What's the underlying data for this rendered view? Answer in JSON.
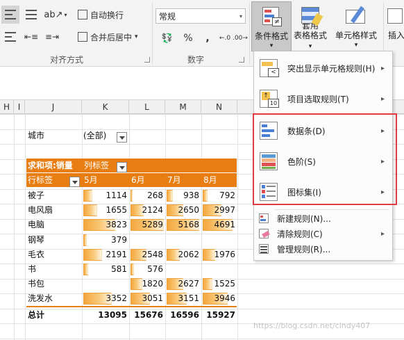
{
  "ribbon": {
    "wrap_text": "自动换行",
    "merge_center": "合并后居中",
    "merge_dd": "▾",
    "align_group": "对齐方式",
    "number_format": "常规",
    "number_group": "数字",
    "percent": "%",
    "comma": ",",
    "cond_format_line1": "条件格式",
    "cond_format_dd": "▾",
    "table_format_line1": "套用",
    "table_format_line2": "表格格式",
    "table_format_dd": "▾",
    "cell_style_line1": "单元格样式",
    "cell_style_dd": "▾",
    "insert_label": "插入"
  },
  "columns": [
    "H",
    "I",
    "J",
    "K",
    "L",
    "M",
    "N"
  ],
  "pivot": {
    "filter_label": "城市",
    "filter_value": "(全部)",
    "value_header": "求和项:销量",
    "col_label_header": "列标签",
    "row_label_header": "行标签",
    "months": [
      "5月",
      "6月",
      "7月",
      "8月"
    ],
    "max_value": 5289,
    "rows": [
      {
        "label": "被子",
        "values": [
          1114,
          268,
          938,
          792
        ]
      },
      {
        "label": "电风扇",
        "values": [
          1655,
          2124,
          2650,
          2997
        ]
      },
      {
        "label": "电脑",
        "values": [
          3823,
          5289,
          5168,
          4691
        ]
      },
      {
        "label": "钢琴",
        "values": [
          379,
          null,
          null,
          null
        ]
      },
      {
        "label": "毛衣",
        "values": [
          2191,
          2548,
          2062,
          1976
        ]
      },
      {
        "label": "书",
        "values": [
          581,
          576,
          null,
          null
        ]
      },
      {
        "label": "书包",
        "values": [
          null,
          1820,
          2627,
          1525
        ]
      },
      {
        "label": "洗发水",
        "values": [
          3352,
          3051,
          3151,
          3946
        ]
      }
    ],
    "total_label": "总计",
    "totals": [
      "13095",
      "15676",
      "16596",
      "15927"
    ]
  },
  "menu": {
    "highlight_rules": "突出显示单元格规则(H)",
    "top_bottom": "项目选取规则(T)",
    "data_bars": "数据条(D)",
    "color_scales": "色阶(S)",
    "icon_sets": "图标集(I)",
    "new_rule": "新建规则(N)...",
    "clear_rules": "清除规则(C)",
    "manage_rules": "管理规则(R)...",
    "arrow": "▸"
  },
  "watermark": "https://blog.csdn.net/cindy407",
  "colors": {
    "pivot_header": "#e87d11",
    "data_bar": "#f4a63c",
    "highlight_border": "#e33b43"
  }
}
